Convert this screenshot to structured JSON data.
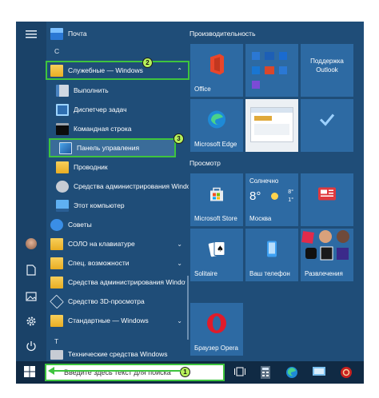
{
  "start_menu": {
    "items": [
      {
        "label": "Почта"
      },
      {
        "label": "С"
      },
      {
        "label": "Служебные — Windows"
      },
      {
        "label": "Выполнить"
      },
      {
        "label": "Диспетчер задач"
      },
      {
        "label": "Командная строка"
      },
      {
        "label": "Панель управления"
      },
      {
        "label": "Проводник"
      },
      {
        "label": "Средства администрирования Windows"
      },
      {
        "label": "Этот компьютер"
      },
      {
        "label": "Советы"
      },
      {
        "label": "СОЛО на клавиатуре"
      },
      {
        "label": "Спец. возможности"
      },
      {
        "label": "Средства администрирования Windows"
      },
      {
        "label": "Средство 3D-просмотра"
      },
      {
        "label": "Стандартные — Windows"
      },
      {
        "label": "Т"
      },
      {
        "label": "Технические средства Windows"
      }
    ],
    "badges": [
      "2",
      "3",
      "1"
    ]
  },
  "groups": {
    "productivity": "Производительность",
    "explore": "Просмотр"
  },
  "tiles": {
    "office": "Office",
    "outlook_line1": "Поддержка",
    "outlook_line2": "Outlook",
    "edge": "Microsoft Edge",
    "store": "Microsoft Store",
    "weather_title": "Солнечно",
    "weather_temp": "8°",
    "weather_temp2": "8°",
    "weather_temp3": "1°",
    "weather_city": "Москва",
    "solitaire": "Solitaire",
    "phone": "Ваш телефон",
    "entertainment": "Развлечения",
    "opera": "Браузер Opera"
  },
  "taskbar": {
    "search_text": "Введите здесь текст для поиска"
  },
  "colors": {
    "accent_highlight": "#3ec43e",
    "badge_fill": "#b7f05a",
    "menu_bg": "#1f4d78",
    "tile_bg": "#2d6aa3"
  }
}
